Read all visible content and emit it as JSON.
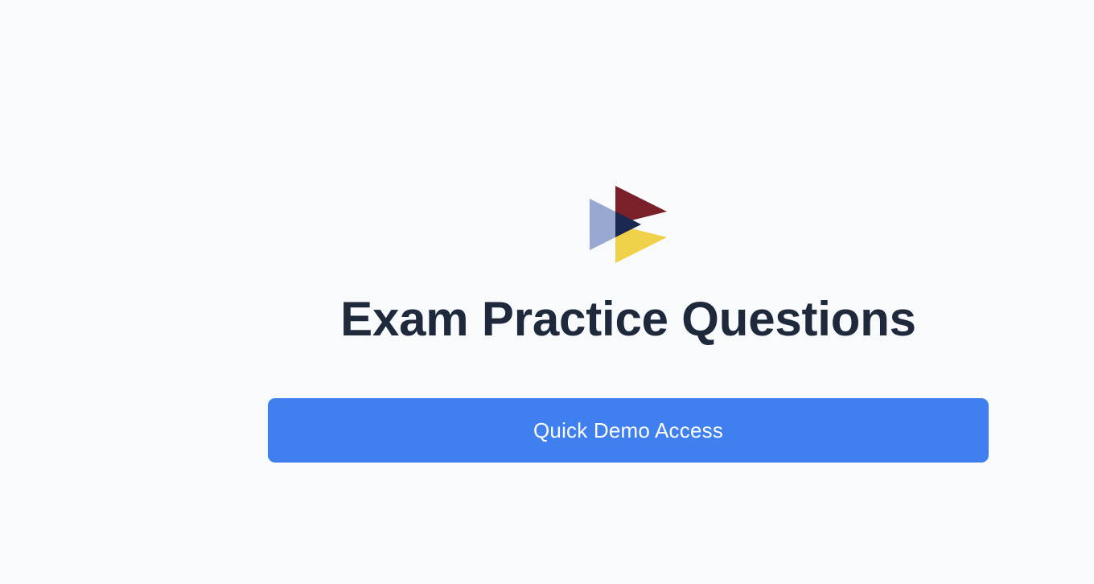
{
  "logo": {
    "icon": "play-triangles-logo",
    "colors": {
      "back": "#98a8d1",
      "top": "#7a2028",
      "bottom": "#f0d24a",
      "overlap": "#1b2850"
    }
  },
  "title": "Exam Practice Questions",
  "demo_button": {
    "label": "Quick Demo Access",
    "color": "#3f7fef"
  },
  "colors": {
    "background": "#f8fafc",
    "title_text": "#1e293b",
    "button_text": "#ffffff"
  }
}
